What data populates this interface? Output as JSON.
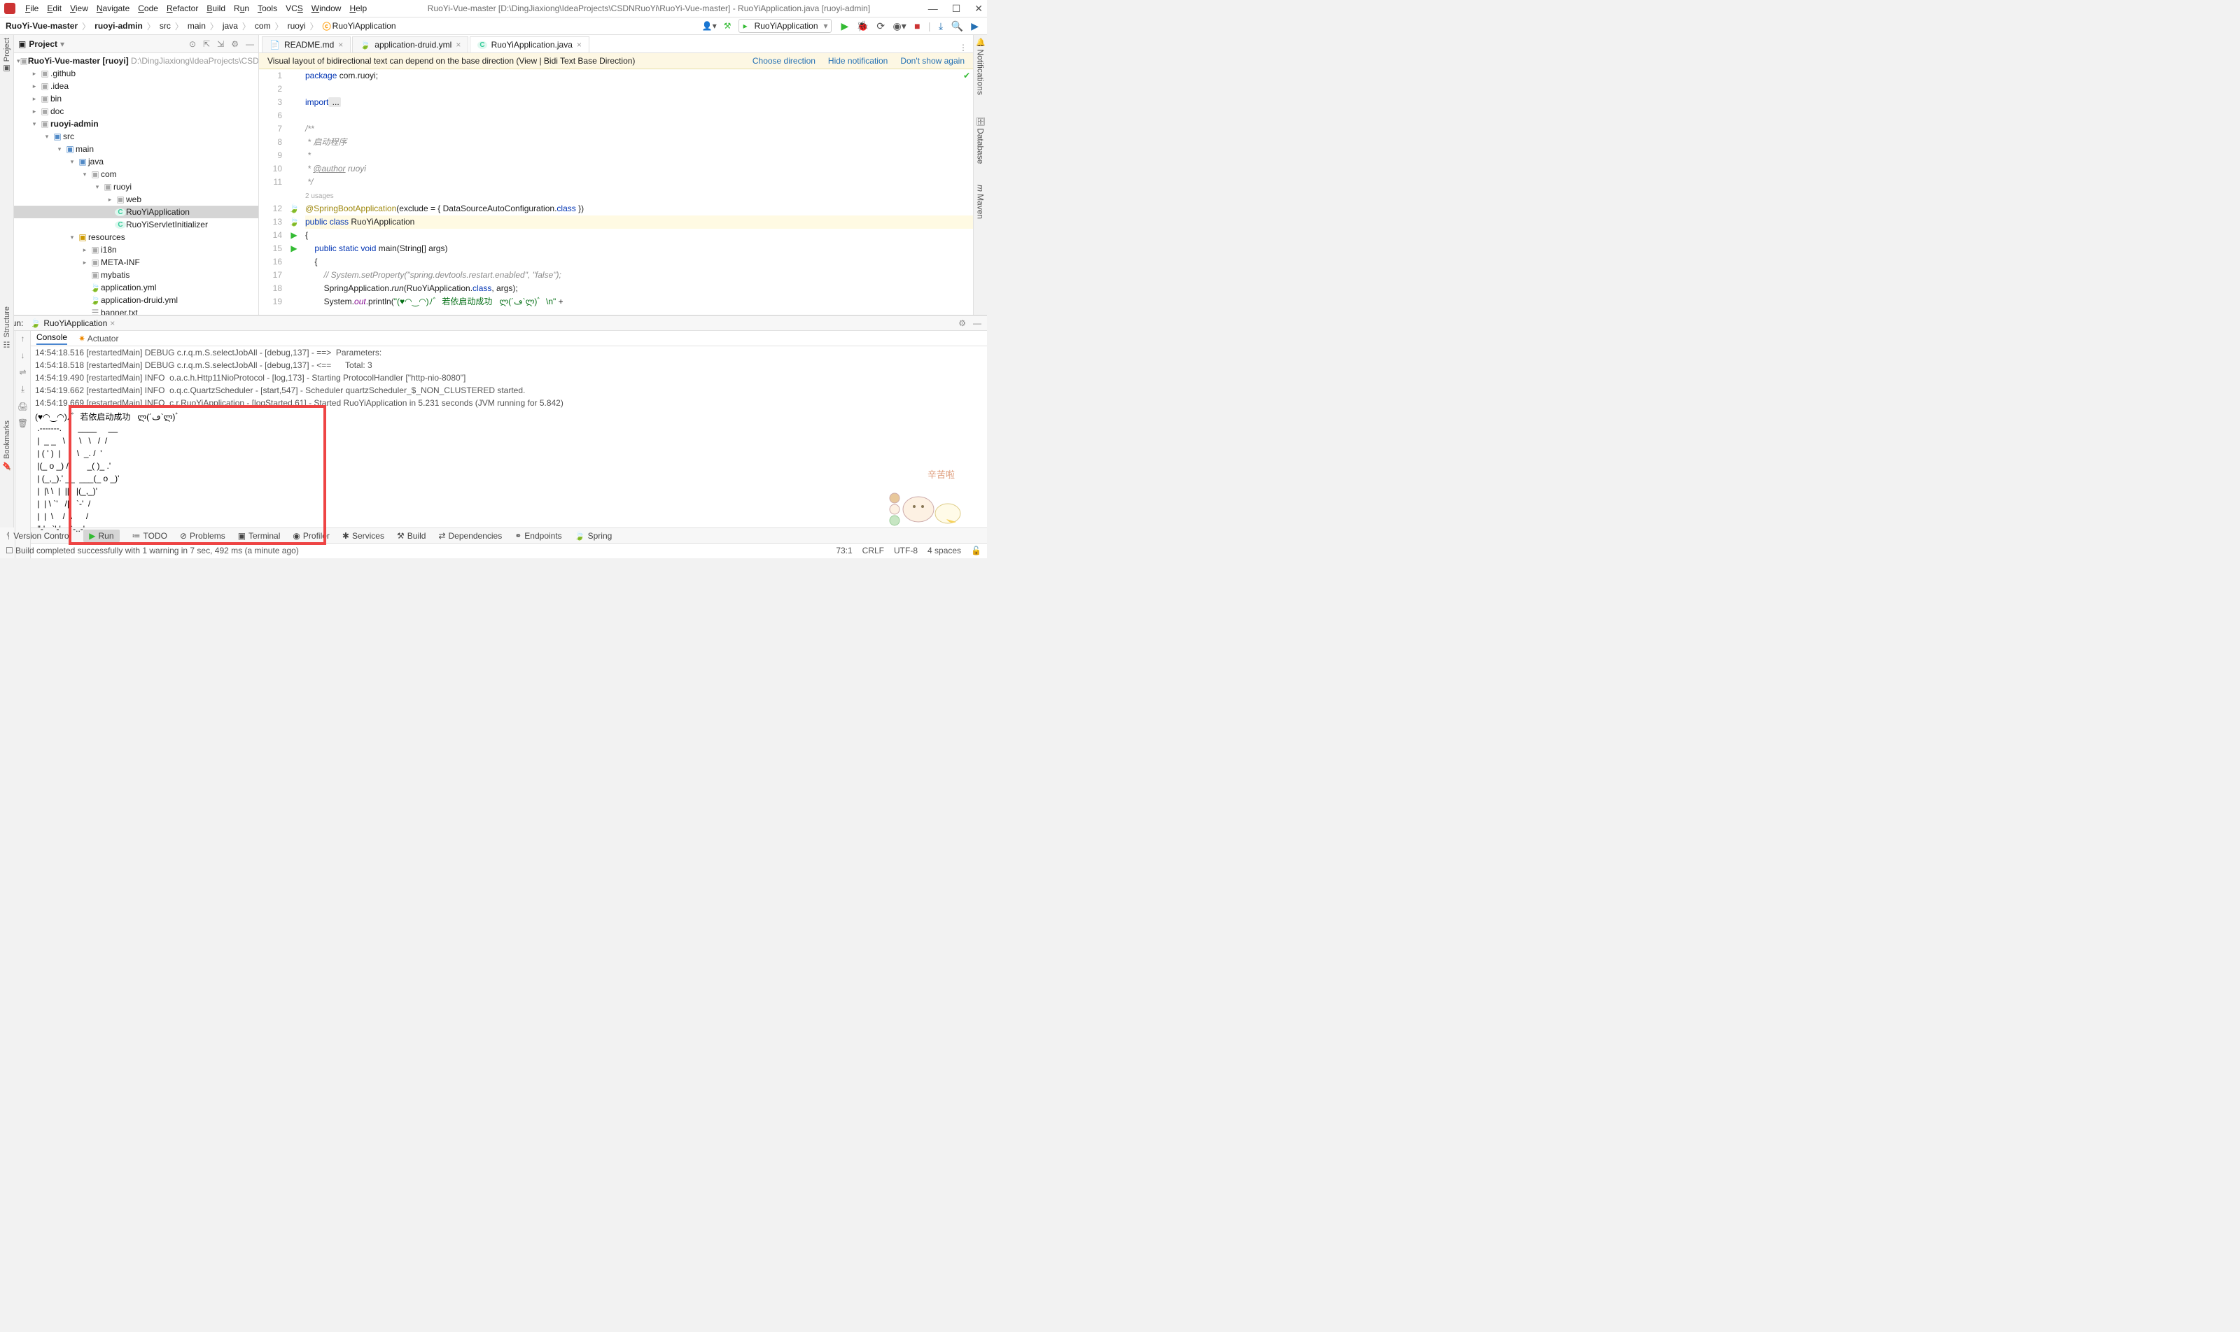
{
  "menu": {
    "file": "File",
    "edit": "Edit",
    "view": "View",
    "navigate": "Navigate",
    "code": "Code",
    "refactor": "Refactor",
    "build": "Build",
    "run": "Run",
    "tools": "Tools",
    "vcs": "VCS",
    "window": "Window",
    "help": "Help"
  },
  "title": "RuoYi-Vue-master [D:\\DingJiaxiong\\IdeaProjects\\CSDNRuoYi\\RuoYi-Vue-master] - RuoYiApplication.java [ruoyi-admin]",
  "crumbs": [
    "RuoYi-Vue-master",
    "ruoyi-admin",
    "src",
    "main",
    "java",
    "com",
    "ruoyi",
    "RuoYiApplication"
  ],
  "run_config": "RuoYiApplication",
  "proj_label": "Project",
  "proj_root": "RuoYi-Vue-master",
  "proj_root_suffix": "[ruoyi]",
  "proj_path": "D:\\DingJiaxiong\\IdeaProjects\\CSDN",
  "tree": {
    "github": ".github",
    "idea": ".idea",
    "bin": "bin",
    "doc": "doc",
    "ruoyi_admin": "ruoyi-admin",
    "src": "src",
    "main": "main",
    "java": "java",
    "com": "com",
    "ruoyi": "ruoyi",
    "web": "web",
    "app": "RuoYiApplication",
    "servlet": "RuoYiServletInitializer",
    "resources": "resources",
    "i18n": "i18n",
    "meta": "META-INF",
    "mybatis": "mybatis",
    "app_yml": "application.yml",
    "druid_yml": "application-druid.yml",
    "banner": "banner.txt"
  },
  "tabs": {
    "readme": "README.md",
    "druid": "application-druid.yml",
    "app": "RuoYiApplication.java"
  },
  "banner": {
    "msg": "Visual layout of bidirectional text can depend on the base direction (View | Bidi Text Base Direction)",
    "choose": "Choose direction",
    "hide": "Hide notification",
    "dont": "Don't show again"
  },
  "code_lines": {
    "1": {
      "kw": "package",
      "rest": " com.ruoyi;"
    },
    "3": {
      "kw": "import",
      "fold": " ..."
    },
    "7": "/**",
    "8": " * 启动程序",
    "9": " * ",
    "10_pref": " * ",
    "10_tag": "@author",
    "10_suf": " ruoyi",
    "11": " */",
    "usages": "2 usages",
    "12_ann": "@SpringBootApplication",
    "12_rest": "(exclude = { DataSourceAutoConfiguration.",
    "12_kw": "class",
    "12_end": " })",
    "13_p": "public",
    "13_c": "class",
    "13_n": " RuoYiApplication",
    "14": "{",
    "15_p": "public",
    "15_s": "static",
    "15_v": "void",
    "15_m": " main",
    "15_args": "(String[] args)",
    "16": "    {",
    "17": "        // System.setProperty(\"spring.devtools.restart.enabled\", \"false\");",
    "18_pre": "        SpringApplication.",
    "18_run": "run",
    "18_mid": "(RuoYiApplication.",
    "18_cls": "class",
    "18_end": ", args);",
    "19_pre": "        System.",
    "19_out": "out",
    "19_prn": ".println(",
    "19_str": "\"(♥◠‿◠)ﾉﾞ  若依启动成功   ლ(´ڡ`ლ)ﾞ  \\n\"",
    "19_end": " +"
  },
  "run_tab_label": "Run:",
  "run_tab_name": "RuoYiApplication",
  "console_tabs": {
    "console": "Console",
    "actuator": "Actuator"
  },
  "log": [
    "14:54:18.516 [restartedMain] DEBUG c.r.q.m.S.selectJobAll - [debug,137] - ==>  Parameters: ",
    "14:54:18.518 [restartedMain] DEBUG c.r.q.m.S.selectJobAll - [debug,137] - <==      Total: 3",
    "14:54:19.490 [restartedMain] INFO  o.a.c.h.Http11NioProtocol - [log,173] - Starting ProtocolHandler [\"http-nio-8080\"]",
    "14:54:19.662 [restartedMain] INFO  o.q.c.QuartzScheduler - [start,547] - Scheduler quartzScheduler_$_NON_CLUSTERED started.",
    "14:54:19.669 [restartedMain] INFO  c.r.RuoYiApplication - [logStarted,61] - Started RuoYiApplication in 5.231 seconds (JVM running for 5.842)"
  ],
  "art": [
    "(♥◠‿◠)ﾉﾞ  若依启动成功   ლ(´ڡ`ლ)ﾞ",
    " .-------.       ____     __       ",
    " |  _ _   \\      \\   \\   /  /    ",
    " | ( ' )  |       \\  _. /  '      ",
    " |(_ o _) /        _( )_ .'       ",
    " | (_,_).' __  ___(_ o _)'        ",
    " |  |\\ \\  |  ||   |(_,_)'        ",
    " |  | \\ `'   /|   `-'  /          ",
    " |  |  \\    /  \\      /          ",
    " ''-'   `'-'    `-..-'             "
  ],
  "mascot_text": "辛苦啦",
  "toolstrip": {
    "vc": "Version Control",
    "run": "Run",
    "todo": "TODO",
    "problems": "Problems",
    "terminal": "Terminal",
    "profiler": "Profiler",
    "services": "Services",
    "build": "Build",
    "deps": "Dependencies",
    "endpoints": "Endpoints",
    "spring": "Spring"
  },
  "status": {
    "msg": "Build completed successfully with 1 warning in 7 sec, 492 ms (a minute ago)",
    "pos": "73:1",
    "crlf": "CRLF",
    "enc": "UTF-8",
    "indent": "4 spaces"
  },
  "side_right": {
    "notif": "Notifications",
    "db": "Database",
    "maven": "Maven"
  }
}
